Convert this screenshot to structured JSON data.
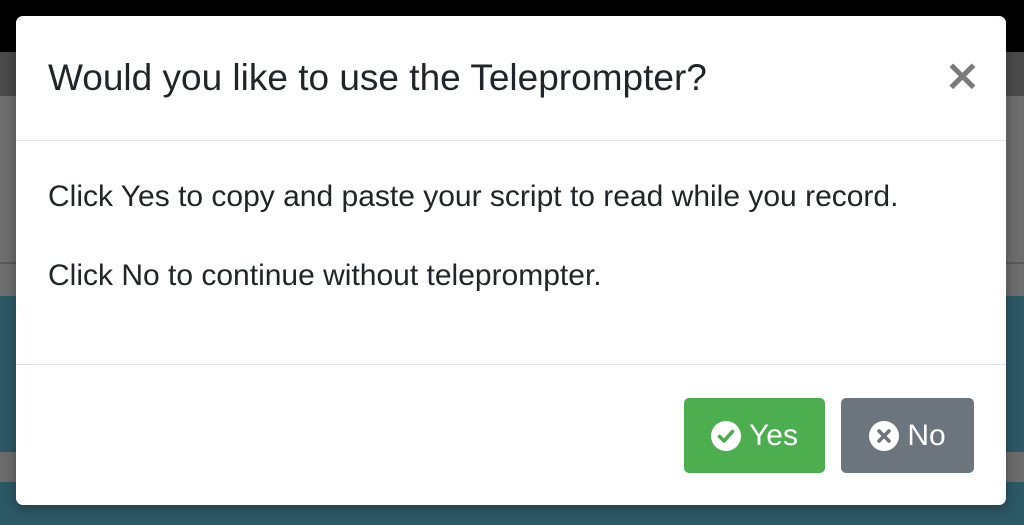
{
  "modal": {
    "title": "Would you like to use the Teleprompter?",
    "close_label": "×",
    "body": {
      "line1": "Click Yes to copy and paste your script to read while you record.",
      "line2": "Click No to continue without teleprompter."
    },
    "footer": {
      "yes_label": "Yes",
      "yes_icon": "check-circle-icon",
      "no_label": "No",
      "no_icon": "times-circle-icon"
    }
  },
  "colors": {
    "yes_button": "#4cae4f",
    "no_button": "#6c757d",
    "title_text": "#212529",
    "backdrop_teal": "#2d5866"
  }
}
